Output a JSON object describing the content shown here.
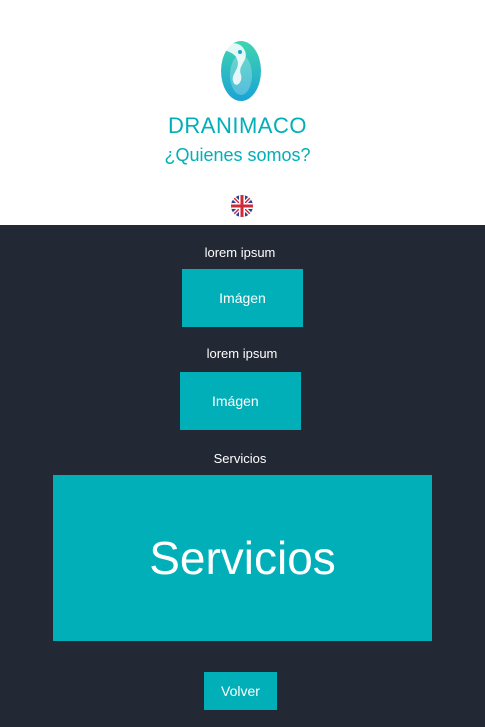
{
  "brand": {
    "name": "DRANIMACO",
    "subtitle": "¿Quienes somos?"
  },
  "icons": {
    "logo": "dragon-logo-icon",
    "language": "uk-flag-icon"
  },
  "colors": {
    "accent": "#00afb8",
    "dark_background": "#222834",
    "light_background": "#ffffff"
  },
  "sections": [
    {
      "title": "lorem ipsum",
      "tile_label": "Imágen"
    },
    {
      "title": "lorem ipsum",
      "tile_label": "Imágen"
    },
    {
      "title": "Servicios",
      "tile_label": "Servicios"
    }
  ],
  "back_button": {
    "label": "Volver"
  }
}
